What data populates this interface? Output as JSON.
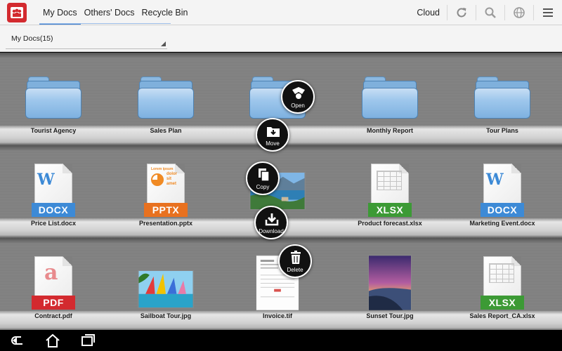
{
  "header": {
    "tabs": [
      {
        "label": "My Docs",
        "active": true
      },
      {
        "label": "Others' Docs",
        "active": false
      },
      {
        "label": "Recycle Bin",
        "active": false
      }
    ],
    "cloud_label": "Cloud",
    "icons": [
      "refresh-icon",
      "search-icon",
      "globe-icon",
      "menu-icon"
    ]
  },
  "folder_selector": {
    "value": "My Docs(15)"
  },
  "shelves": [
    {
      "items": [
        {
          "name": "Tourist Agency",
          "kind": "folder"
        },
        {
          "name": "Sales Plan",
          "kind": "folder"
        },
        {
          "name": "der",
          "kind": "folder"
        },
        {
          "name": "Monthly Report",
          "kind": "folder"
        },
        {
          "name": "Tour Plans",
          "kind": "folder"
        }
      ]
    },
    {
      "items": [
        {
          "name": "Price List.docx",
          "kind": "docx",
          "badge": "DOCX"
        },
        {
          "name": "Presentation.pptx",
          "kind": "pptx",
          "badge": "PPTX"
        },
        {
          "name": ".jpg",
          "kind": "photo-lake"
        },
        {
          "name": "Product forecast.xlsx",
          "kind": "xlsx",
          "badge": "XLSX"
        },
        {
          "name": "Marketing Event.docx",
          "kind": "docx",
          "badge": "DOCX"
        }
      ]
    },
    {
      "items": [
        {
          "name": "Contract.pdf",
          "kind": "pdf",
          "badge": "PDF"
        },
        {
          "name": "Sailboat Tour.jpg",
          "kind": "photo-sail"
        },
        {
          "name": "Invoice.tif",
          "kind": "photo-invoice"
        },
        {
          "name": "Sunset Tour.jpg",
          "kind": "photo-sunset"
        },
        {
          "name": "Sales Report_CA.xlsx",
          "kind": "xlsx",
          "badge": "XLSX"
        }
      ]
    }
  ],
  "context_menu": {
    "open": "Open",
    "move": "Move",
    "copy": "Copy",
    "download": "Download",
    "delete": "Delete"
  },
  "ppt_thumb": {
    "title": "Lorem ipsum",
    "lines": "dolor sit amet"
  },
  "colors": {
    "accent": "#3b7fd4",
    "brand_red": "#d32a2f",
    "docx": "#3d8ad6",
    "pptx": "#e8711f",
    "xlsx": "#3c9a35",
    "pdf": "#d32a2f"
  }
}
